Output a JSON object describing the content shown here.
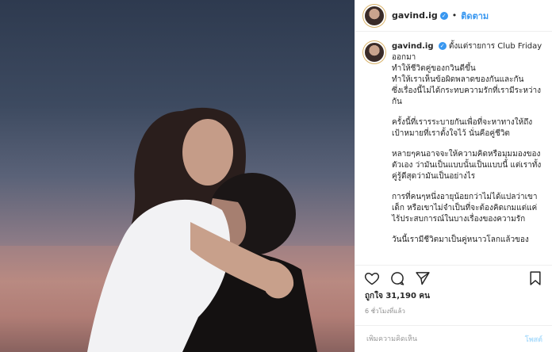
{
  "header": {
    "username": "gavind.ig",
    "separator": "•",
    "follow_label": "ติดตาม"
  },
  "caption": {
    "username": "gavind.ig",
    "paragraphs": [
      "ตั้งแต่รายการ Club Friday ออกมา\nทำให้ชีวิตคู่ของกวินดีขึ้น\nทำให้เราเห็นข้อผิดพลาดของกันและกัน\nซึ่งเรื่องนี้ไม่ได้กระทบความรักที่เรามีระหว่างกัน",
      "ครั้งนี้ที่เรารระบายกันเพื่อที่จะหาทางให้ถึงเป้าหมายที่เราตั้งใจไว้ นั่นคือคู่ชีวิต",
      "หลายๆคนอาจจะให้ความคิดหรือมุมมองของตัวเอง ว่ามันเป็นแบบนั้นเป็นแบบนี้ แต่เราทั้งคู่รู้ดีสุดว่ามันเป็นอย่างไร",
      "การที่คนๆหนึ่งอายุน้อยกว่าไม่ได้แปลว่าเขาเด็ก หรือเขาไม่จำเป็นที่จะต้องคิดเกมแต่แค่ไร้ประสบการณ์ในบางเรื่องของความรัก",
      "วันนี้เรามีชีวิตมาเป็นคู่หนาวโลกแล้วของ"
    ]
  },
  "icons": {
    "like": "heart-icon",
    "comment": "comment-bubble-icon",
    "share": "paper-plane-icon",
    "save": "bookmark-icon",
    "verified": "verified-badge-icon"
  },
  "likes_text": "ถูกใจ 31,190 คน",
  "timestamp": "6 ชั่วโมงที่แล้ว",
  "comment": {
    "placeholder": "เพิ่มความคิดเห็น",
    "post_label": "โพสต์"
  },
  "colors": {
    "accent": "#3897f0",
    "post_disabled": "#b2dffc"
  }
}
